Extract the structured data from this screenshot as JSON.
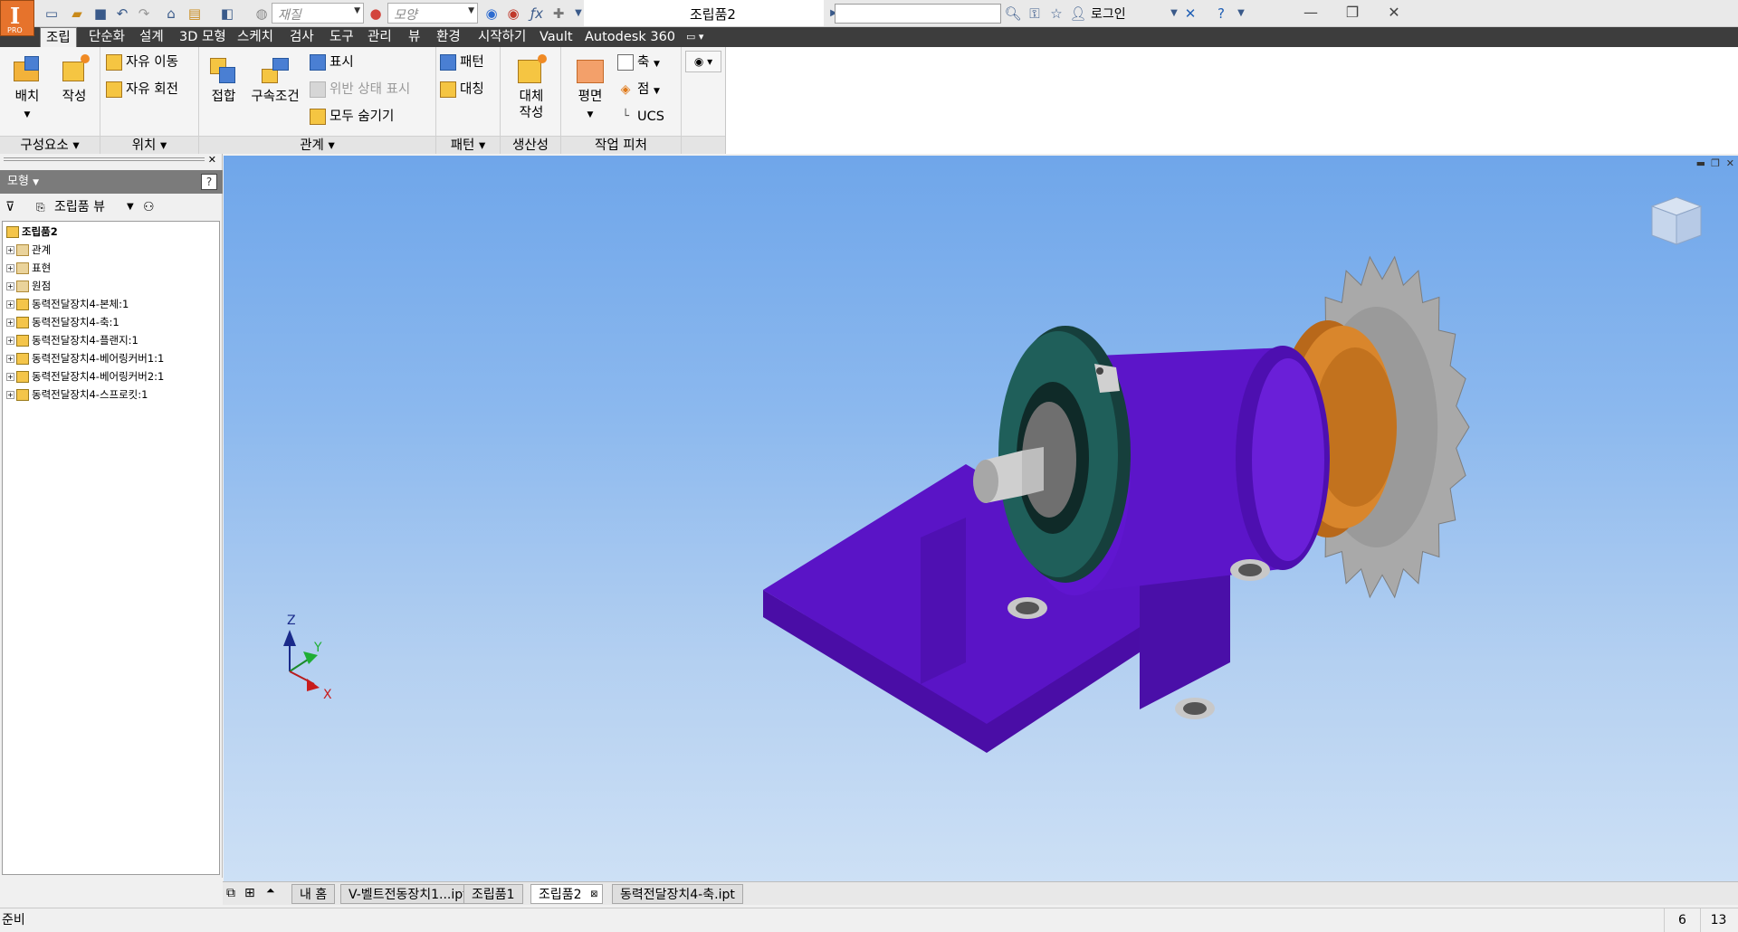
{
  "app": {
    "logo_letter": "I",
    "logo_sub": "PRO"
  },
  "qat": {
    "material_placeholder": "재질",
    "appearance_placeholder": "모양",
    "document_title": "조립품2",
    "login_label": "로그인"
  },
  "ribbon_tabs": [
    "조립",
    "단순화",
    "설계",
    "3D 모형",
    "스케치",
    "검사",
    "도구",
    "관리",
    "뷰",
    "환경",
    "시작하기",
    "Vault",
    "Autodesk 360"
  ],
  "ribbon": {
    "component": {
      "title": "구성요소",
      "place_label": "배치",
      "create_label": "작성"
    },
    "position": {
      "title": "위치",
      "free_move_label": "자유 이동",
      "free_rotate_label": "자유 회전"
    },
    "relationships": {
      "title": "관계",
      "join_label": "접합",
      "constrain_label": "구속조건",
      "show_label": "표시",
      "show_sick_label": "위반 상태 표시",
      "hide_all_label": "모두 숨기기"
    },
    "pattern": {
      "title": "패턴",
      "pattern_label": "패턴",
      "mirror_label": "대칭"
    },
    "productivity": {
      "title": "생산성",
      "substitute_label_1": "대체",
      "substitute_label_2": "작성"
    },
    "work_features": {
      "title": "작업 피처",
      "plane_label": "평면",
      "axis_label": "축",
      "point_label": "점",
      "ucs_label": "UCS"
    }
  },
  "browser": {
    "header_label": "모형",
    "view_label": "조립품 뷰",
    "root": "조립품2",
    "items": [
      {
        "label": "관계",
        "type": "folder"
      },
      {
        "label": "표현",
        "type": "folder"
      },
      {
        "label": "원점",
        "type": "folder"
      },
      {
        "label": "동력전달장치4-본체:1",
        "type": "part"
      },
      {
        "label": "동력전달장치4-축:1",
        "type": "part"
      },
      {
        "label": "동력전달장치4-플랜지:1",
        "type": "part"
      },
      {
        "label": "동력전달장치4-베어링커버1:1",
        "type": "part"
      },
      {
        "label": "동력전달장치4-베어링커버2:1",
        "type": "part"
      },
      {
        "label": "동력전달장치4-스프로킷:1",
        "type": "part"
      }
    ]
  },
  "triad": {
    "x": "X",
    "y": "Y",
    "z": "Z"
  },
  "doc_tabs": [
    "내 홈",
    "V-벨트전동장치1...ipt",
    "조립품1",
    "조립품2",
    "동력전달장치4-축.ipt"
  ],
  "active_doc_tab": "조립품2",
  "status": {
    "text": "준비",
    "count1": "6",
    "count2": "13"
  },
  "colors": {
    "body": "#5b12c4",
    "flange": "#1f5f5a",
    "sprocket": "#a9a9a9",
    "bearing": "#c9761c",
    "logo": "#e6732c"
  }
}
